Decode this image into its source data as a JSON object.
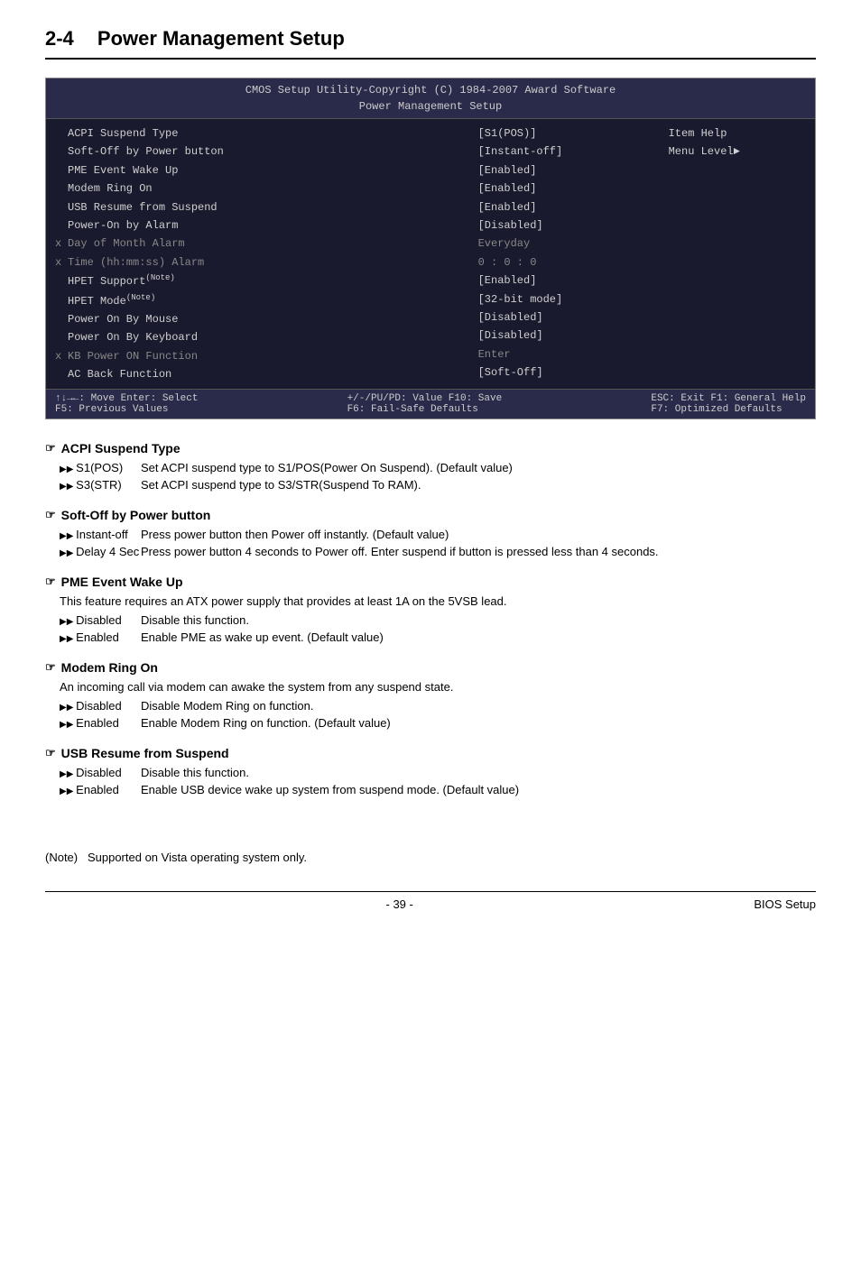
{
  "title": {
    "number": "2-4",
    "text": "Power Management Setup"
  },
  "cmos": {
    "header_line1": "CMOS Setup Utility-Copyright (C) 1984-2007 Award Software",
    "header_line2": "Power Management Setup",
    "rows": [
      {
        "prefix": " ",
        "label": "ACPI Suspend Type",
        "value": "[S1(POS)]",
        "dimmed": false
      },
      {
        "prefix": " ",
        "label": "Soft-Off by Power button",
        "value": "[Instant-off]",
        "dimmed": false
      },
      {
        "prefix": " ",
        "label": "PME Event Wake Up",
        "value": "[Enabled]",
        "dimmed": false
      },
      {
        "prefix": " ",
        "label": "Modem Ring On",
        "value": "[Enabled]",
        "dimmed": false
      },
      {
        "prefix": " ",
        "label": "USB Resume from Suspend",
        "value": "[Enabled]",
        "dimmed": false
      },
      {
        "prefix": " ",
        "label": "Power-On by Alarm",
        "value": "[Disabled]",
        "dimmed": false
      },
      {
        "prefix": "x",
        "label": "Day of Month Alarm",
        "value": "Everyday",
        "dimmed": true
      },
      {
        "prefix": "x",
        "label": "Time (hh:mm:ss) Alarm",
        "value": "0 : 0 : 0",
        "dimmed": true
      },
      {
        "prefix": " ",
        "label": "HPET Support⁺ᴺoteᵀ⁾",
        "value": "[Enabled]",
        "dimmed": false,
        "note": true
      },
      {
        "prefix": " ",
        "label": "HPET Mode⁺ᴺoteᵀ⁾",
        "value": "[32-bit mode]",
        "dimmed": false,
        "note": true
      },
      {
        "prefix": " ",
        "label": "Power On By Mouse",
        "value": "[Disabled]",
        "dimmed": false
      },
      {
        "prefix": " ",
        "label": "Power On By Keyboard",
        "value": "[Disabled]",
        "dimmed": false
      },
      {
        "prefix": "x",
        "label": "KB Power ON Function",
        "value": "Enter",
        "dimmed": true
      },
      {
        "prefix": " ",
        "label": "AC Back Function",
        "value": "[Soft-Off]",
        "dimmed": false
      }
    ],
    "help_line1": "Item Help",
    "help_line2": "Menu Level►",
    "footer": {
      "col1_line1": "↑↓→←: Move    Enter: Select",
      "col1_line2": "F5: Previous Values",
      "col2_line1": "+/-/PU/PD: Value    F10: Save",
      "col2_line2": "F6: Fail-Safe Defaults",
      "col3_line1": "ESC: Exit    F1: General Help",
      "col3_line2": "F7: Optimized Defaults"
    }
  },
  "sections": [
    {
      "id": "acpi-suspend",
      "title": "ACPI Suspend Type",
      "desc": null,
      "items": [
        {
          "bullet": "S1(POS)",
          "desc": "Set ACPI suspend type to S1/POS(Power On Suspend). (Default value)"
        },
        {
          "bullet": "S3(STR)",
          "desc": "Set ACPI suspend type to S3/STR(Suspend To RAM)."
        }
      ]
    },
    {
      "id": "soft-off",
      "title": "Soft-Off by Power button",
      "desc": null,
      "items": [
        {
          "bullet": "Instant-off",
          "desc": "Press power button then Power off instantly. (Default value)"
        },
        {
          "bullet": "Delay 4 Sec",
          "desc": "Press power button 4 seconds to Power off. Enter suspend if button is pressed less than 4 seconds."
        }
      ]
    },
    {
      "id": "pme-event",
      "title": "PME Event Wake Up",
      "desc": "This feature requires an ATX power supply that provides at least 1A on the 5VSB lead.",
      "items": [
        {
          "bullet": "Disabled",
          "desc": "Disable this function."
        },
        {
          "bullet": "Enabled",
          "desc": "Enable PME as wake up event. (Default value)"
        }
      ]
    },
    {
      "id": "modem-ring",
      "title": "Modem Ring On",
      "desc": "An incoming call via modem can awake the system from any suspend state.",
      "items": [
        {
          "bullet": "Disabled",
          "desc": "Disable Modem Ring on function."
        },
        {
          "bullet": "Enabled",
          "desc": "Enable Modem Ring on function. (Default value)"
        }
      ]
    },
    {
      "id": "usb-resume",
      "title": "USB Resume from Suspend",
      "desc": null,
      "items": [
        {
          "bullet": "Disabled",
          "desc": "Disable this function."
        },
        {
          "bullet": "Enabled",
          "desc": "Enable USB device wake up system from suspend mode. (Default value)"
        }
      ]
    }
  ],
  "note": {
    "label": "(Note)",
    "text": "Supported on Vista operating system only."
  },
  "footer": {
    "page": "- 39 -",
    "right": "BIOS Setup"
  }
}
